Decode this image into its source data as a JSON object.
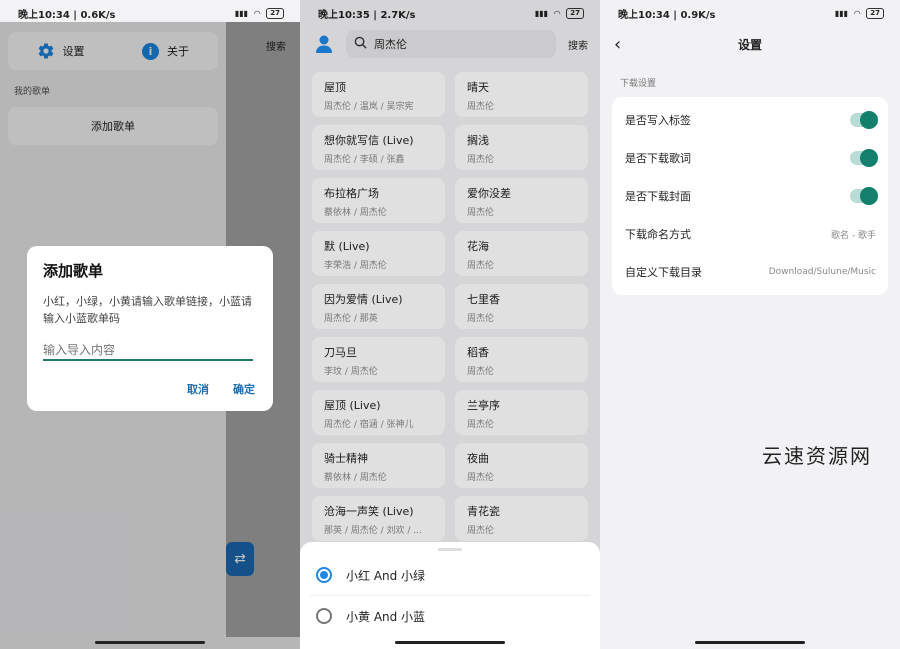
{
  "phone1": {
    "status": {
      "time": "晚上10:34 | 0.6K/s",
      "battery": "27"
    },
    "menu": {
      "settings": "设置",
      "about": "关于"
    },
    "my_playlists_label": "我的歌单",
    "add_playlist_label": "添加歌单",
    "drawer_search": "搜索",
    "dialog": {
      "title": "添加歌单",
      "message": "小红，小绿，小黄请输入歌单链接，小蓝请输入小蓝歌单码",
      "input_placeholder": "输入导入内容",
      "cancel": "取消",
      "confirm": "确定"
    }
  },
  "phone2": {
    "status": {
      "time": "晚上10:35 | 2.7K/s",
      "battery": "27"
    },
    "search_query": "周杰伦",
    "search_button": "搜索",
    "songs": [
      {
        "title": "屋顶",
        "artist": "周杰伦 / 温岚 / 吴宗宪"
      },
      {
        "title": "晴天",
        "artist": "周杰伦"
      },
      {
        "title": "想你就写信 (Live)",
        "artist": "周杰伦 / 李硕 / 张鑫"
      },
      {
        "title": "搁浅",
        "artist": "周杰伦"
      },
      {
        "title": "布拉格广场",
        "artist": "蔡依林 / 周杰伦"
      },
      {
        "title": "爱你没差",
        "artist": "周杰伦"
      },
      {
        "title": "默 (Live)",
        "artist": "李荣浩 / 周杰伦"
      },
      {
        "title": "花海",
        "artist": "周杰伦"
      },
      {
        "title": "因为爱情 (Live)",
        "artist": "周杰伦 / 那英"
      },
      {
        "title": "七里香",
        "artist": "周杰伦"
      },
      {
        "title": "刀马旦",
        "artist": "李玟 / 周杰伦"
      },
      {
        "title": "稻香",
        "artist": "周杰伦"
      },
      {
        "title": "屋顶 (Live)",
        "artist": "周杰伦 / 宿涵 / 张神儿"
      },
      {
        "title": "兰亭序",
        "artist": "周杰伦"
      },
      {
        "title": "骑士精神",
        "artist": "蔡依林 / 周杰伦"
      },
      {
        "title": "夜曲",
        "artist": "周杰伦"
      },
      {
        "title": "沧海一声笑 (Live)",
        "artist": "那英 / 周杰伦 / 刘欢 / ..."
      },
      {
        "title": "青花瓷",
        "artist": "周杰伦"
      }
    ],
    "sources": [
      {
        "label": "小红 And 小绿",
        "selected": true
      },
      {
        "label": "小黄 And 小蓝",
        "selected": false
      }
    ]
  },
  "phone3": {
    "status": {
      "time": "晚上10:34 | 0.9K/s",
      "battery": "27"
    },
    "title": "设置",
    "section": "下载设置",
    "rows": [
      {
        "label": "是否写入标签",
        "type": "toggle",
        "on": true
      },
      {
        "label": "是否下载歌词",
        "type": "toggle",
        "on": true
      },
      {
        "label": "是否下载封面",
        "type": "toggle",
        "on": true
      },
      {
        "label": "下载命名方式",
        "type": "value",
        "value": "歌名 - 歌手"
      },
      {
        "label": "自定义下载目录",
        "type": "value",
        "value": "Download/Sulune/Music"
      }
    ]
  },
  "watermark": "云速资源网",
  "colors": {
    "accent_blue": "#1e88e5",
    "toggle_green": "#12806d",
    "dialog_button": "#1a6fb5"
  }
}
